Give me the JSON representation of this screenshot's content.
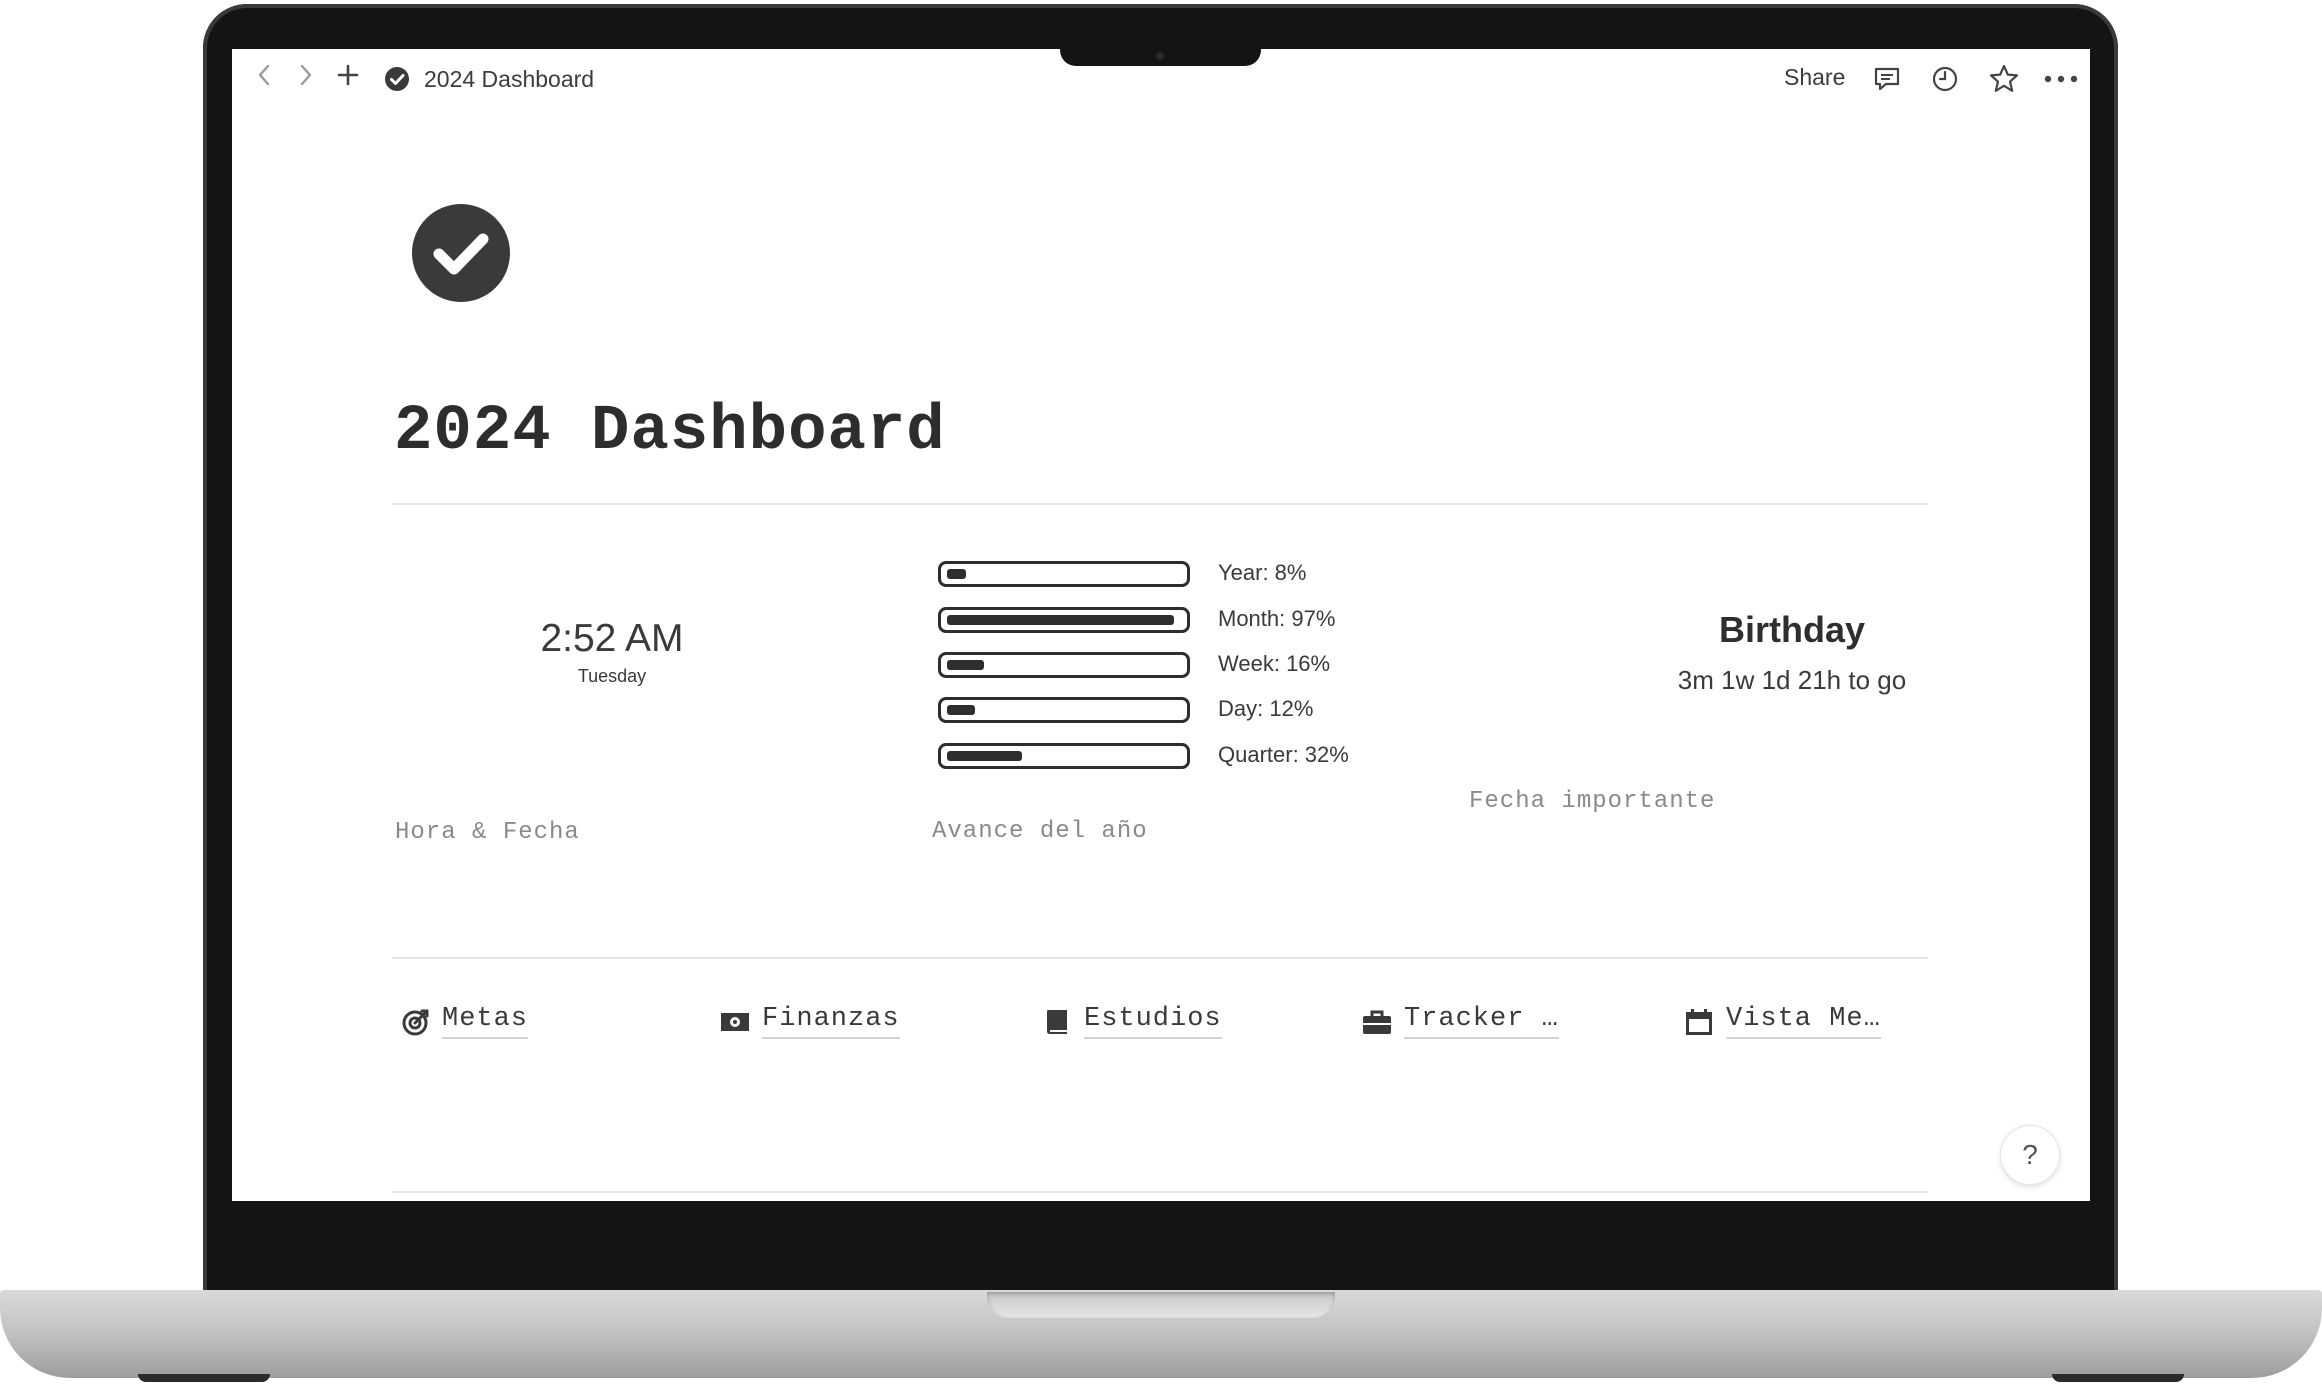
{
  "topbar": {
    "page_title": "2024 Dashboard",
    "share_label": "Share",
    "icons": [
      "back-arrow-icon",
      "forward-arrow-icon",
      "plus-icon",
      "check-circle-icon",
      "comment-icon",
      "clock-history-icon",
      "star-icon",
      "more-icon"
    ]
  },
  "page": {
    "title": "2024 Dashboard",
    "icon": "check-circle-icon"
  },
  "clock_widget": {
    "time": "2:52 AM",
    "day": "Tuesday",
    "caption": "Hora & Fecha"
  },
  "progress_widget": {
    "caption": "Avance del año",
    "bars": [
      {
        "label": "Year: 8%",
        "percent": 8
      },
      {
        "label": "Month: 97%",
        "percent": 97
      },
      {
        "label": "Week: 16%",
        "percent": 16
      },
      {
        "label": "Day: 12%",
        "percent": 12
      },
      {
        "label": "Quarter: 32%",
        "percent": 32
      }
    ]
  },
  "countdown_widget": {
    "title": "Birthday",
    "subtitle": "3m 1w 1d 21h to go",
    "caption": "Fecha importante"
  },
  "links": [
    {
      "label": "Metas",
      "icon": "target-icon"
    },
    {
      "label": "Finanzas",
      "icon": "money-icon"
    },
    {
      "label": "Estudios",
      "icon": "book-icon"
    },
    {
      "label": "Tracker …",
      "icon": "briefcase-icon"
    },
    {
      "label": "Vista Me…",
      "icon": "calendar-icon"
    }
  ],
  "help_label": "?"
}
